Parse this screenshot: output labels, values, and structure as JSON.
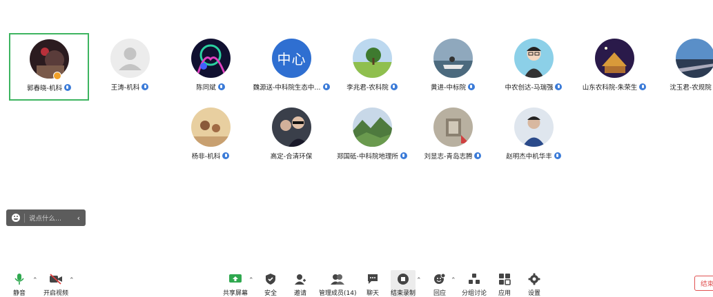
{
  "participants": [
    {
      "name": "郭春晓-机科",
      "avatar": "photo-dark",
      "active": true,
      "host": true
    },
    {
      "name": "王涛-机科",
      "avatar": "default-user-icon"
    },
    {
      "name": "陈同斌",
      "avatar": "photo-neon"
    },
    {
      "name": "魏源送-中科院生态中...",
      "avatar": "text-avatar",
      "avatar_text": "中心",
      "avatar_color": "#2f6fd1"
    },
    {
      "name": "李兆君-农科院",
      "avatar": "photo-tree"
    },
    {
      "name": "黄进-中标院",
      "avatar": "photo-jetski"
    },
    {
      "name": "中农创达-马瑞强",
      "avatar": "photo-cartoon"
    },
    {
      "name": "山东农科院-朱荣生",
      "avatar": "photo-night"
    },
    {
      "name": "沈玉君-农规院",
      "avatar": "photo-road"
    },
    {
      "name": "杨非-机科",
      "avatar": "photo-child"
    },
    {
      "name": "高定-合清环保",
      "avatar": "photo-men"
    },
    {
      "name": "郑国砥-中科院地理所",
      "avatar": "photo-mountain"
    },
    {
      "name": "刘显志-青岛志腾",
      "avatar": "photo-wall"
    },
    {
      "name": "赵明杰中机华丰",
      "avatar": "photo-portrait"
    }
  ],
  "chat": {
    "placeholder": "说点什么..."
  },
  "toolbar": {
    "mute": "静音",
    "video": "开启视频",
    "share": "共享屏幕",
    "security": "安全",
    "invite": "邀请",
    "members": "管理成员(14)",
    "chat": "聊天",
    "record": "结束录制",
    "reaction": "回应",
    "breakout": "分组讨论",
    "apps": "应用",
    "settings": "设置",
    "end": "结束会议"
  },
  "colors": {
    "accent_green": "#3cb45f",
    "mic_blue": "#3b7bd8",
    "end_red": "#e05050"
  }
}
